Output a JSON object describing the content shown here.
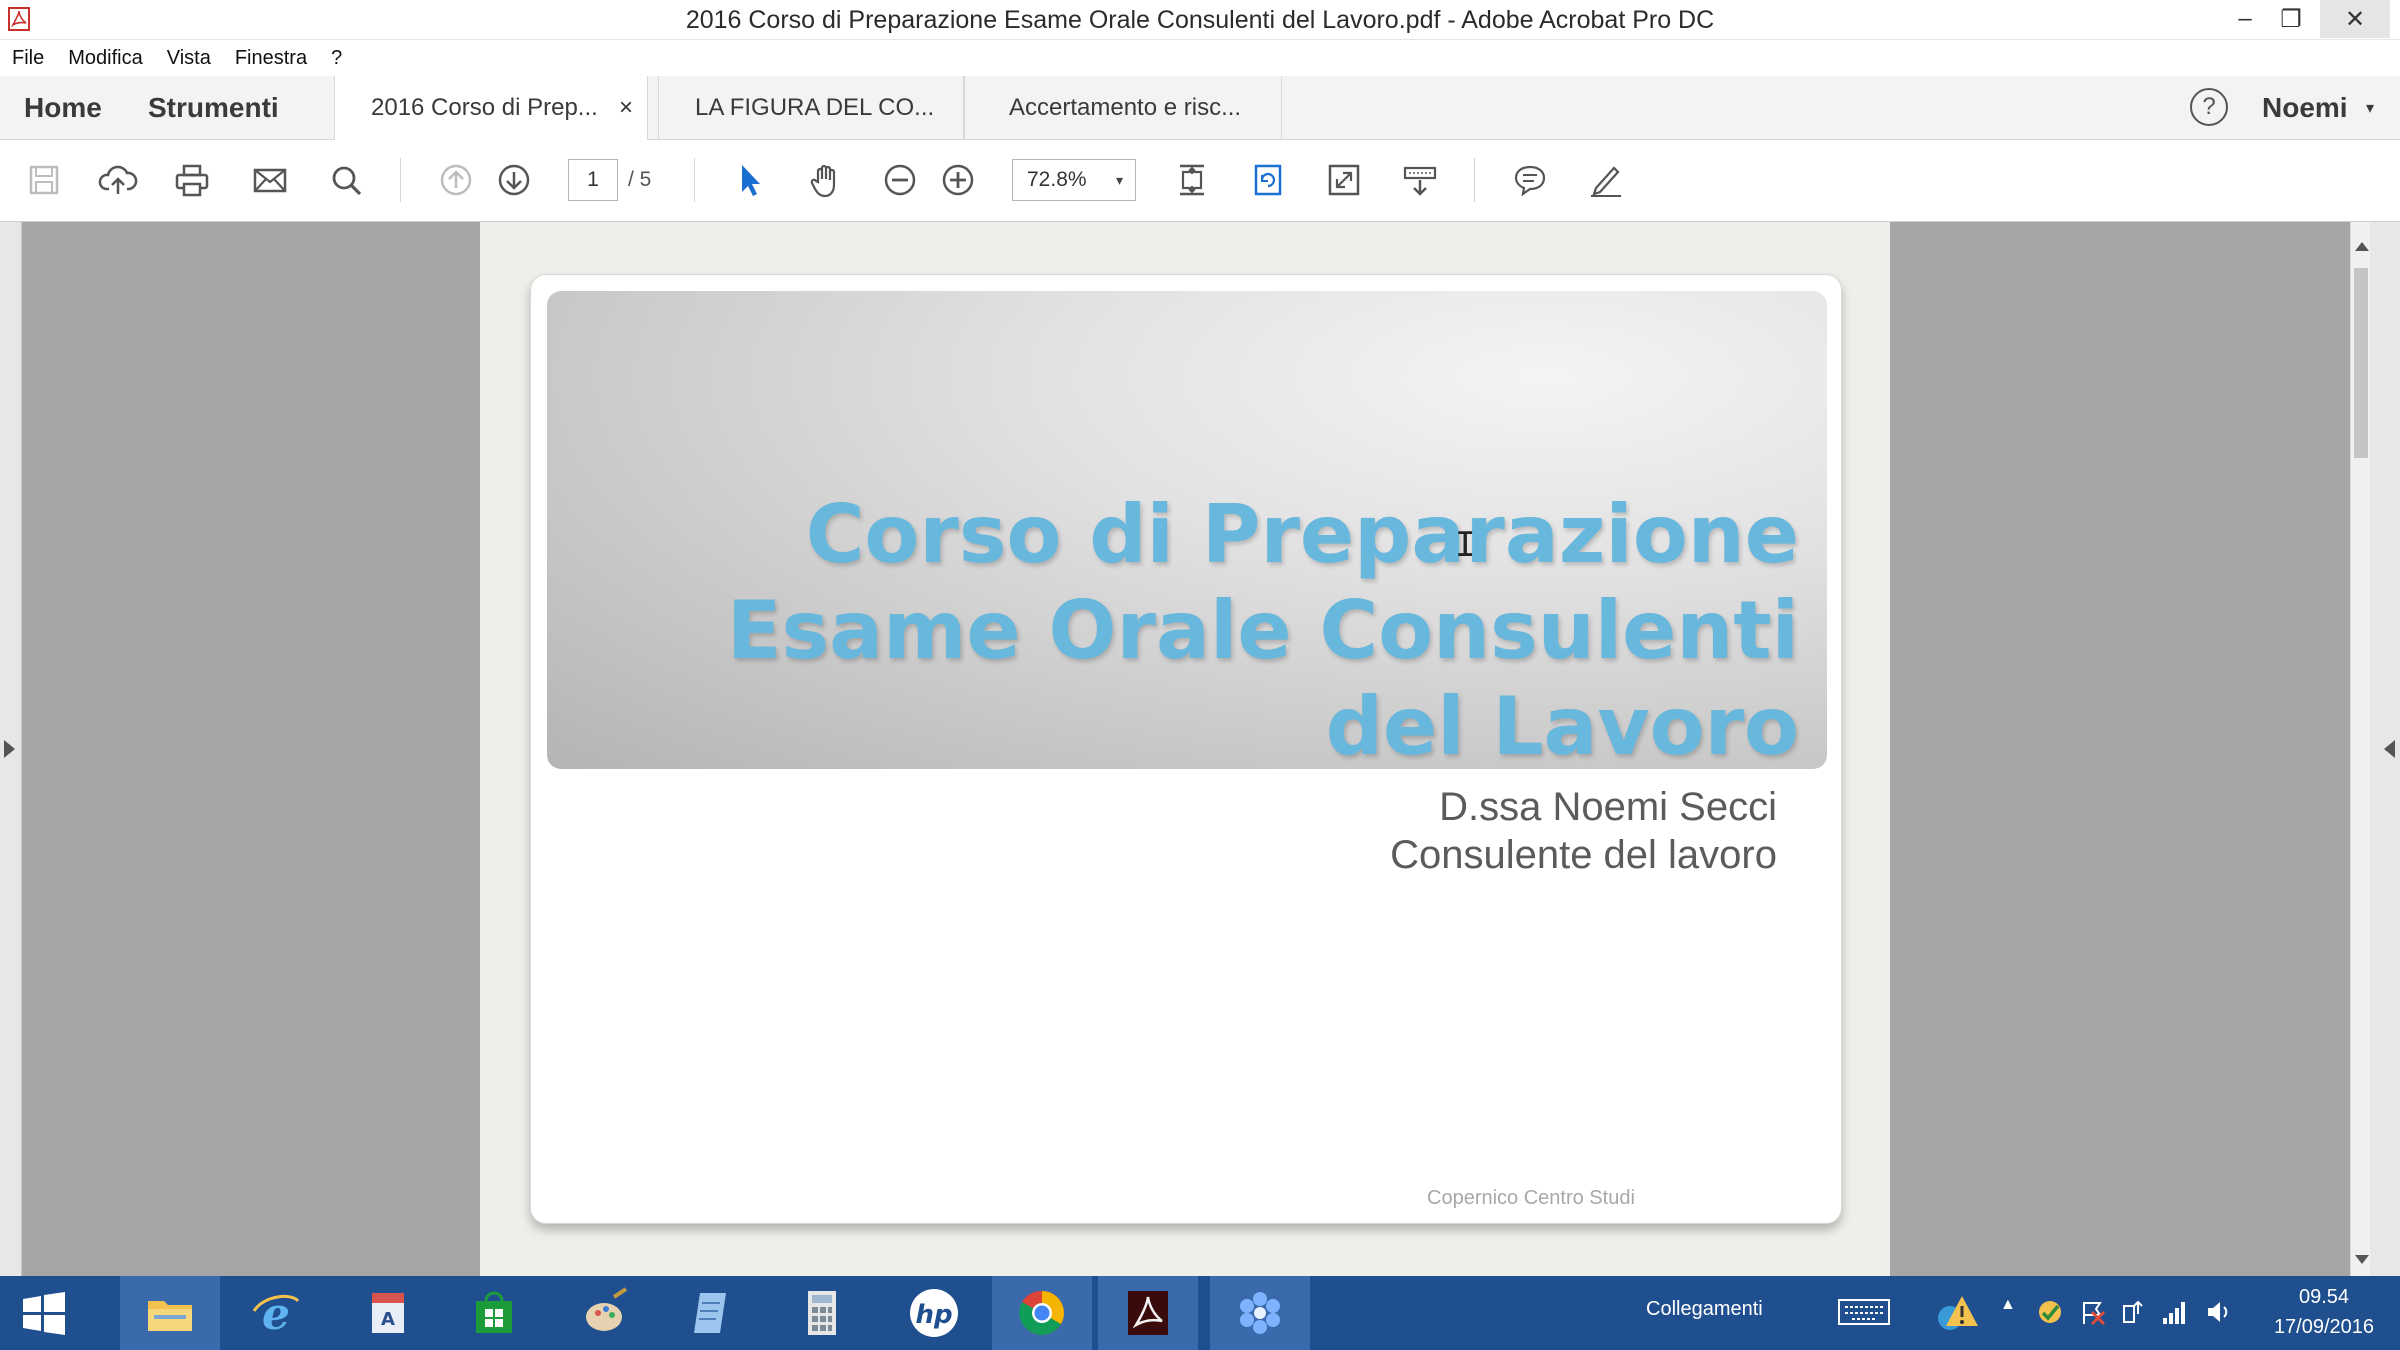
{
  "window": {
    "title": "2016 Corso di Preparazione Esame Orale Consulenti del Lavoro.pdf - Adobe Acrobat Pro DC",
    "minimize": "–",
    "restore": "❐",
    "close": "✕"
  },
  "menubar": {
    "items": [
      "File",
      "Modifica",
      "Vista",
      "Finestra",
      "?"
    ]
  },
  "tabs": {
    "home": "Home",
    "tools": "Strumenti",
    "documents": [
      {
        "label": "2016 Corso di Prep...",
        "active": true,
        "close": "×"
      },
      {
        "label": "LA FIGURA DEL CO...",
        "active": false
      },
      {
        "label": "Accertamento e risc...",
        "active": false
      }
    ],
    "help": "?",
    "user": "Noemi",
    "user_caret": "▾"
  },
  "toolbar": {
    "icons": [
      "save-icon",
      "upload-icon",
      "print-icon",
      "email-icon",
      "search-icon",
      "prev-page-icon",
      "next-page-icon",
      "select-arrow-icon",
      "hand-icon",
      "zoom-out-icon",
      "zoom-in-icon",
      "fit-page-icon",
      "rotate-icon",
      "full-screen-icon",
      "read-mode-icon",
      "comment-icon",
      "pen-icon"
    ],
    "page_current": "1",
    "page_total": "/ 5",
    "zoom": "72.8%",
    "zoom_caret": "▾"
  },
  "slide": {
    "title_lines": [
      "Corso di Preparazione",
      "Esame Orale Consulenti",
      "del Lavoro"
    ],
    "author_lines": [
      "D.ssa Noemi Secci",
      "Consulente del lavoro"
    ],
    "footer": "Copernico Centro Studi",
    "title_color": "#68b7dc"
  },
  "taskbar": {
    "apps": [
      "start-icon",
      "file-explorer-icon",
      "internet-explorer-icon",
      "dictionary-icon",
      "store-icon",
      "paint-icon",
      "notes-icon",
      "calculator-icon",
      "hp-icon",
      "chrome-icon",
      "acrobat-icon",
      "snowflake-app-icon"
    ],
    "links_label": "Collegamenti",
    "time": "09.54",
    "date": "17/09/2016",
    "accent": "#1f4f8f"
  }
}
